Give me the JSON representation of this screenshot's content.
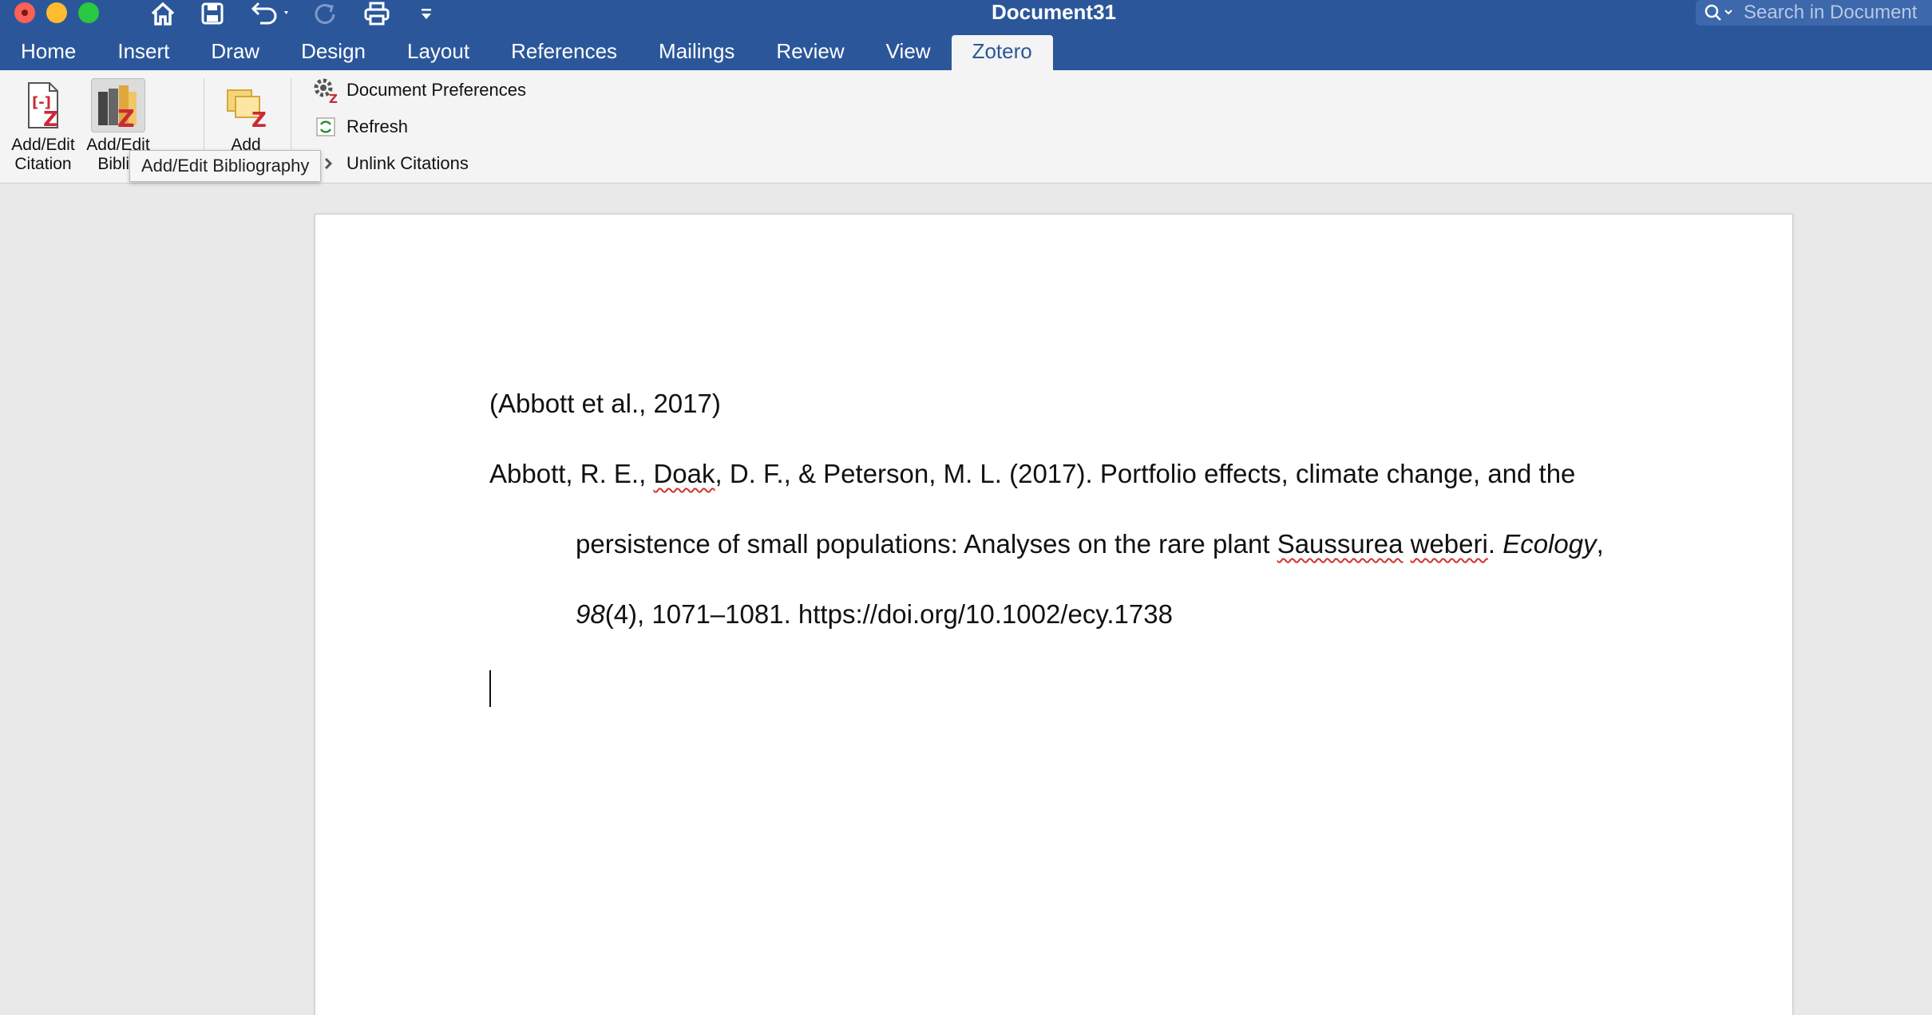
{
  "window": {
    "title": "Document31"
  },
  "search": {
    "placeholder": "Search in Document"
  },
  "tabs": [
    {
      "label": "Home"
    },
    {
      "label": "Insert"
    },
    {
      "label": "Draw"
    },
    {
      "label": "Design"
    },
    {
      "label": "Layout"
    },
    {
      "label": "References"
    },
    {
      "label": "Mailings"
    },
    {
      "label": "Review"
    },
    {
      "label": "View"
    },
    {
      "label": "Zotero",
      "active": true
    }
  ],
  "ribbon": {
    "add_edit_citation": {
      "line1": "Add/Edit",
      "line2": "Citation"
    },
    "add_edit_bibliography": {
      "line1": "Add/Edit",
      "line2": "Biblio"
    },
    "add_note": {
      "line1": "Add"
    },
    "document_preferences": "Document Preferences",
    "refresh": "Refresh",
    "unlink_citations": "Unlink Citations"
  },
  "tooltip": {
    "text": "Add/Edit Bibliography"
  },
  "document": {
    "citation": "(Abbott et al., 2017)",
    "reference": {
      "line1_a": "Abbott, R. E., ",
      "line1_b": "Doak",
      "line1_c": ", D. F., & Peterson, M. L. (2017). Portfolio effects, climate change, and the",
      "line2_a": "persistence of small populations: Analyses on the rare plant ",
      "line2_b": "Saussurea",
      "line2_c": " ",
      "line2_d": "weberi",
      "line2_e": ". ",
      "line2_f": "Ecology",
      "line2_g": ",",
      "line3_a": "98",
      "line3_b": "(4), 1071–1081. https://doi.org/10.1002/ecy.1738"
    }
  },
  "colors": {
    "ribbon_blue": "#2b579a",
    "ribbon_bg": "#f4f4f4",
    "zotero_red": "#cc2936",
    "canvas_gray": "#e9e9e9"
  }
}
